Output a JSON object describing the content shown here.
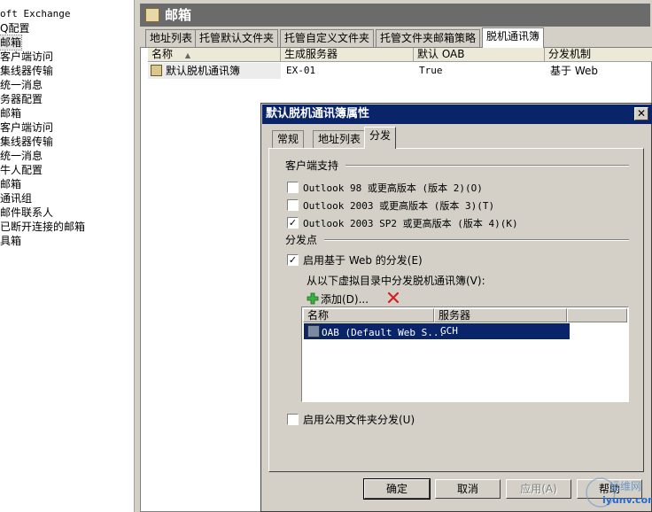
{
  "tree": {
    "items": [
      {
        "label": "oft Exchange",
        "mono": true
      },
      {
        "label": "Q配置"
      },
      {
        "label": "邮箱",
        "selected": true
      },
      {
        "label": "客户端访问"
      },
      {
        "label": "集线器传输"
      },
      {
        "label": "统一消息"
      },
      {
        "label": "务器配置"
      },
      {
        "label": "邮箱"
      },
      {
        "label": "客户端访问"
      },
      {
        "label": "集线器传输"
      },
      {
        "label": "统一消息"
      },
      {
        "label": "牛人配置"
      },
      {
        "label": "邮箱"
      },
      {
        "label": "通讯组"
      },
      {
        "label": "邮件联系人"
      },
      {
        "label": "已断开连接的邮箱"
      },
      {
        "label": "具箱"
      }
    ]
  },
  "right_pane": {
    "title": "邮箱",
    "tabs": [
      "地址列表",
      "托管默认文件夹",
      "托管自定义文件夹",
      "托管文件夹邮箱策略",
      "脱机通讯簿"
    ],
    "active_tab": 4,
    "columns": [
      "名称",
      "生成服务器",
      "默认 OAB",
      "分发机制"
    ],
    "sort_indicator": "▲",
    "rows": [
      {
        "name": "默认脱机通讯簿",
        "server": "EX-01",
        "default_oab": "True",
        "mechanism": "基于 Web"
      }
    ]
  },
  "dialog": {
    "title": "默认脱机通讯簿属性",
    "close_glyph": "✕",
    "tabs": [
      "常规",
      "地址列表",
      "分发"
    ],
    "active_tab": 2,
    "client_support_label": "客户端支持",
    "checkboxes": [
      {
        "label": "Outlook 98 或更高版本 (版本 2)(O)",
        "checked": false
      },
      {
        "label": "Outlook 2003 或更高版本 (版本 3)(T)",
        "checked": false
      },
      {
        "label": "Outlook 2003 SP2 或更高版本 (版本 4)(K)",
        "checked": true
      }
    ],
    "dist_points_label": "分发点",
    "web_dist": {
      "label": "启用基于 Web 的分发(E)",
      "checked": true
    },
    "vdir_label": "从以下虚拟目录中分发脱机通讯簿(V):",
    "add_label": "添加(D)...",
    "list_columns": [
      "名称",
      "服务器"
    ],
    "list_rows": [
      {
        "name": "OAB (Default Web S...",
        "server": "GCH"
      }
    ],
    "public_folder": {
      "label": "启用公用文件夹分发(U)",
      "checked": false
    },
    "buttons": {
      "ok": "确定",
      "cancel": "取消",
      "apply": "应用(A)",
      "help": "帮助"
    }
  },
  "watermark": {
    "line1": "运维网",
    "line2": "iyunv.com"
  },
  "colors": {
    "selection": "#0a246a",
    "dialog_face": "#d4d0c8",
    "title_bar": "#6b6b6b"
  }
}
